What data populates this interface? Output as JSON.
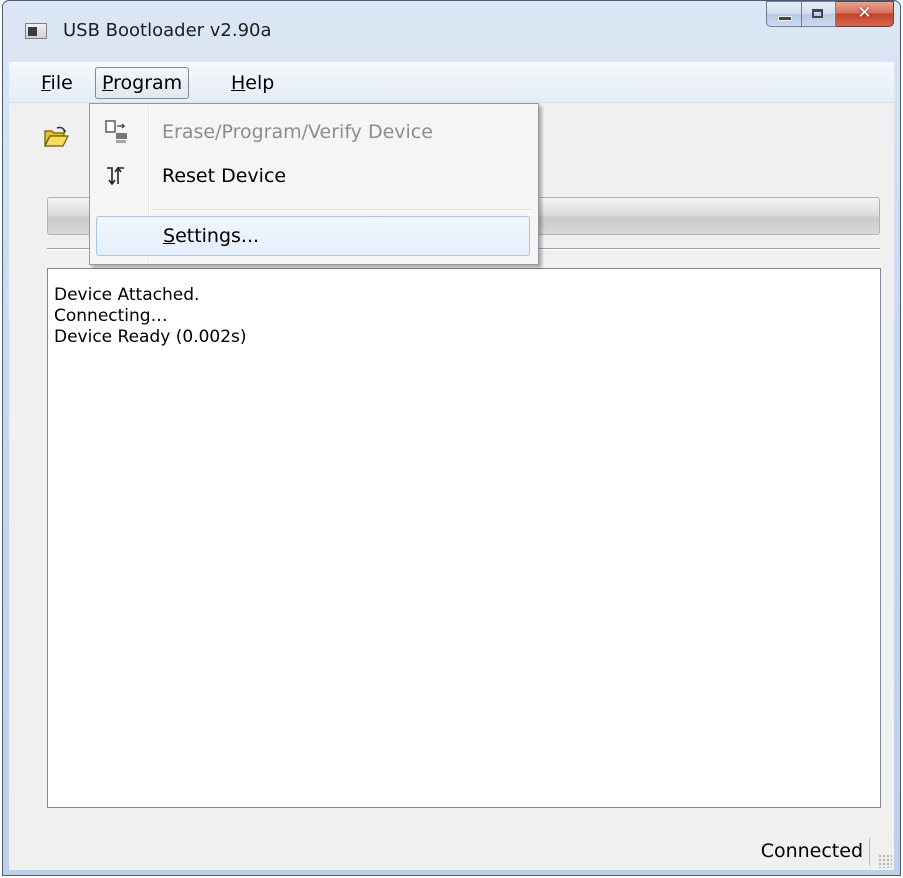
{
  "window": {
    "title": "USB Bootloader v2.90a",
    "accent": "#c2432a"
  },
  "menubar": {
    "items": [
      {
        "label_u": "F",
        "label_rest": "ile"
      },
      {
        "label_u": "P",
        "label_rest": "rogram"
      },
      {
        "label_u": "H",
        "label_rest": "elp"
      }
    ],
    "active_index": 1
  },
  "toolbar": {
    "open_icon": "folder-open-icon"
  },
  "progress": {
    "fraction": 0
  },
  "program_menu": {
    "items": [
      {
        "label": "Erase/Program/Verify Device",
        "icon": "program-device-icon",
        "enabled": false
      },
      {
        "label": "Reset Device",
        "icon": "reset-device-icon",
        "enabled": true
      },
      {
        "label_u": "S",
        "label_rest": "ettings...",
        "enabled": true,
        "highlighted": true
      }
    ]
  },
  "log": {
    "lines": [
      "Device Attached.",
      "Connecting…",
      "Device Ready (0.002s)"
    ]
  },
  "status": {
    "text": "Connected"
  }
}
